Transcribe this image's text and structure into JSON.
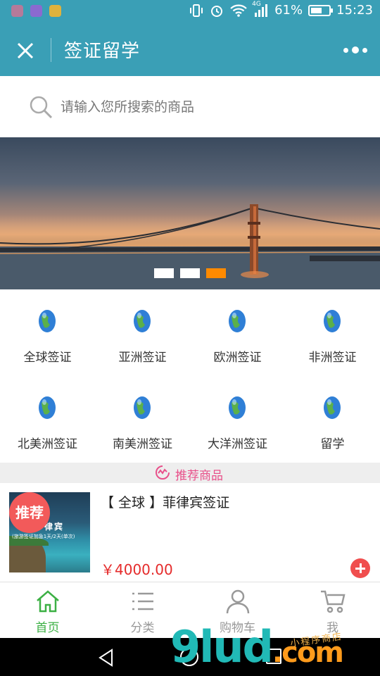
{
  "status_bar": {
    "network": "4G",
    "battery": "61%",
    "battery_level": 0.61,
    "time": "15:23"
  },
  "nav": {
    "title": "签证留学"
  },
  "search": {
    "placeholder": "请输入您所搜索的商品"
  },
  "banner": {
    "slide_count": 3,
    "active_slide": 3
  },
  "categories": [
    {
      "label": "全球签证"
    },
    {
      "label": "亚洲签证"
    },
    {
      "label": "欧洲签证"
    },
    {
      "label": "非洲签证"
    },
    {
      "label": "北美洲签证"
    },
    {
      "label": "南美洲签证"
    },
    {
      "label": "大洋洲签证"
    },
    {
      "label": "留学"
    }
  ],
  "section": {
    "title": "推荐商品"
  },
  "product": {
    "badge": "推荐",
    "title": "【 全球 】菲律宾签证",
    "price": "￥4000.00",
    "image_title": "律宾",
    "image_subtitle": "(旅游签证加急1天/2天(单次)"
  },
  "tabs": [
    {
      "label": "首页",
      "icon": "home-icon",
      "active": true
    },
    {
      "label": "分类",
      "icon": "list-icon",
      "active": false
    },
    {
      "label": "购物车",
      "icon": "user-icon",
      "active": false
    },
    {
      "label": "我",
      "icon": "cart-icon",
      "active": false
    }
  ],
  "watermark": {
    "main": "9lud",
    "suffix": ".com",
    "small": "小程序商店"
  },
  "colors": {
    "header": "#3a9fb6",
    "accent_green": "#3cb044",
    "price_red": "#e52b2b",
    "section_pink": "#e8508a",
    "active_dot": "#ff8a00"
  }
}
